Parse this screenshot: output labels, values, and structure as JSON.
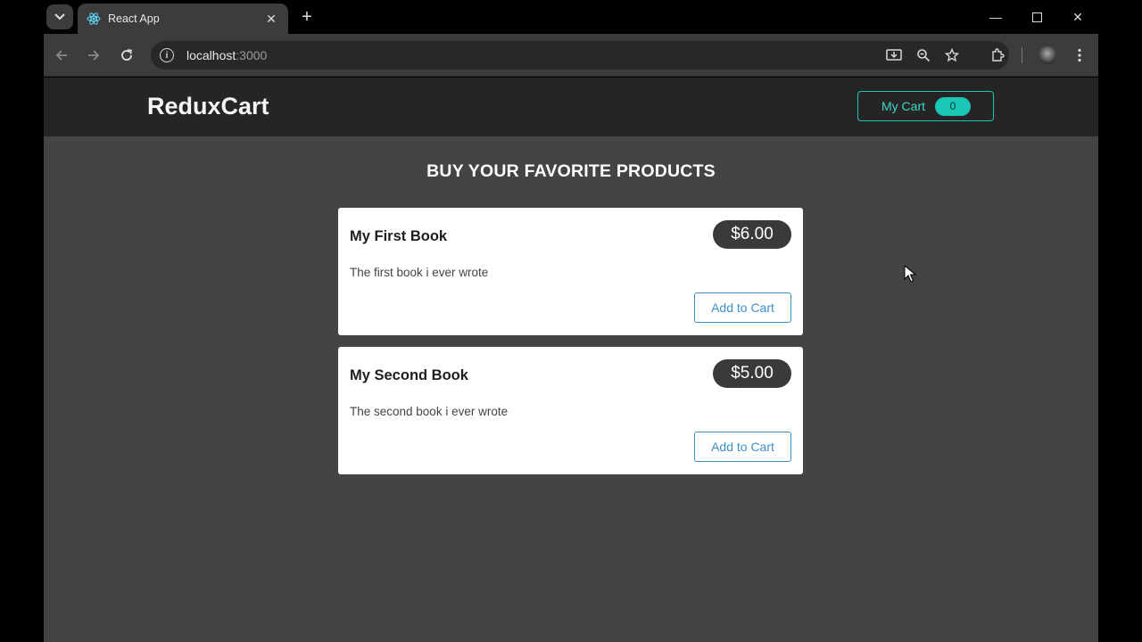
{
  "browser": {
    "tab_title": "React App",
    "url_host": "localhost",
    "url_port": ":3000"
  },
  "app": {
    "brand": "ReduxCart",
    "cart_label": "My Cart",
    "cart_count": "0",
    "heading": "BUY YOUR FAVORITE PRODUCTS",
    "products": [
      {
        "title": "My First Book",
        "price": "$6.00",
        "description": "The first book i ever wrote",
        "button": "Add to Cart"
      },
      {
        "title": "My Second Book",
        "price": "$5.00",
        "description": "The second book i ever wrote",
        "button": "Add to Cart"
      }
    ]
  },
  "colors": {
    "accent": "#1ac6b6",
    "button_blue": "#3e8fc4",
    "page_bg": "#444444",
    "navbar_bg": "#252525"
  },
  "icons": [
    "tab-search-icon",
    "react-favicon",
    "close-icon",
    "new-tab-icon",
    "back-icon",
    "forward-icon",
    "reload-icon",
    "site-info-icon",
    "install-icon",
    "zoom-icon",
    "bookmark-star-icon",
    "extensions-icon",
    "profile-avatar",
    "menu-kebab-icon",
    "mouse-cursor-icon"
  ]
}
